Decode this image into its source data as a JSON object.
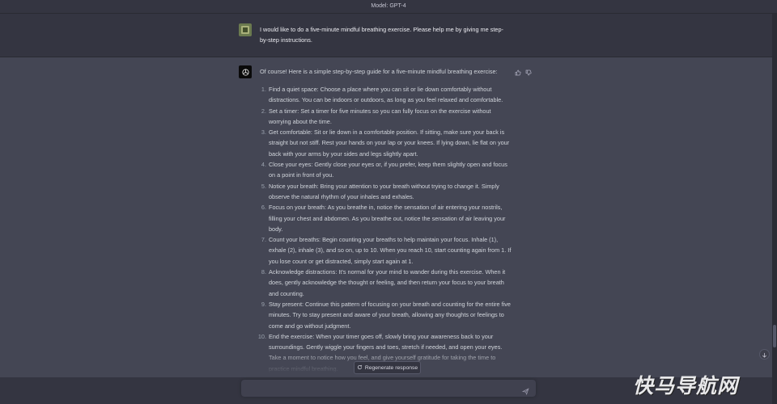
{
  "header": {
    "model_label": "Model: GPT-4"
  },
  "user_message": {
    "text": "I would like to do a five-minute mindful breathing exercise. Please help me by giving me step-by-step instructions."
  },
  "assistant_message": {
    "intro": "Of course! Here is a simple step-by-step guide for a five-minute mindful breathing exercise:",
    "steps": [
      {
        "num": "1.",
        "text": "Find a quiet space: Choose a place where you can sit or lie down comfortably without distractions. You can be indoors or outdoors, as long as you feel relaxed and comfortable."
      },
      {
        "num": "2.",
        "text": "Set a timer: Set a timer for five minutes so you can fully focus on the exercise without worrying about the time."
      },
      {
        "num": "3.",
        "text": "Get comfortable: Sit or lie down in a comfortable position. If sitting, make sure your back is straight but not stiff. Rest your hands on your lap or your knees. If lying down, lie flat on your back with your arms by your sides and legs slightly apart."
      },
      {
        "num": "4.",
        "text": "Close your eyes: Gently close your eyes or, if you prefer, keep them slightly open and focus on a point in front of you."
      },
      {
        "num": "5.",
        "text": "Notice your breath: Bring your attention to your breath without trying to change it. Simply observe the natural rhythm of your inhales and exhales."
      },
      {
        "num": "6.",
        "text": "Focus on your breath: As you breathe in, notice the sensation of air entering your nostrils, filling your chest and abdomen. As you breathe out, notice the sensation of air leaving your body."
      },
      {
        "num": "7.",
        "text": "Count your breaths: Begin counting your breaths to help maintain your focus. Inhale (1), exhale (2), inhale (3), and so on, up to 10. When you reach 10, start counting again from 1. If you lose count or get distracted, simply start again at 1."
      },
      {
        "num": "8.",
        "text": "Acknowledge distractions: It's normal for your mind to wander during this exercise. When it does, gently acknowledge the thought or feeling, and then return your focus to your breath and counting."
      },
      {
        "num": "9.",
        "text": "Stay present: Continue this pattern of focusing on your breath and counting for the entire five minutes. Try to stay present and aware of your breath, allowing any thoughts or feelings to come and go without judgment."
      },
      {
        "num": "10.",
        "text": "End the exercise: When your timer goes off, slowly bring your awareness back to your surroundings. Gently wiggle your fingers and toes, stretch if needed, and open your eyes. Take a moment to notice how you feel, and give yourself gratitude for taking the time to practice mindful breathing."
      }
    ]
  },
  "controls": {
    "regenerate_label": "Regenerate response",
    "input_placeholder": ""
  },
  "watermark": {
    "text": "快马导航网"
  },
  "colors": {
    "background": "#343541",
    "assistant_background": "#444654",
    "input_background": "#40414f",
    "text": "#d1d5db"
  },
  "icons": [
    "user-avatar",
    "openai-logo-icon",
    "thumbs-up-icon",
    "thumbs-down-icon",
    "refresh-icon",
    "send-icon",
    "arrow-down-icon"
  ]
}
